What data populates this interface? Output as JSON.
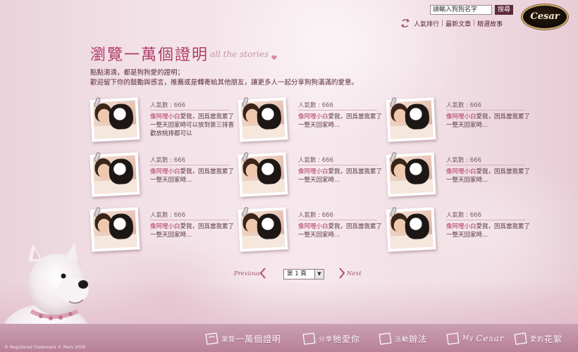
{
  "header": {
    "search_placeholder": "請輸入狗狗名字",
    "search_button": "搜尋",
    "links": [
      "人氣排行",
      "最新文章",
      "精選故事"
    ],
    "logo_text": "Cesar"
  },
  "title": {
    "main": "瀏覽一萬個證明",
    "sub": "all the stories"
  },
  "intro": {
    "line1": "點點滴滴，都是狗狗愛的證明；",
    "line2": "歡迎留下你的鼓勵與感言，推薦或是轉寄給其他朋友，讓更多人一起分享狗狗滿滿的愛意。"
  },
  "stories": [
    {
      "popularity": "人氣數 : 666",
      "highlight": "像阿哩小白",
      "text": "愛我，因爲當我累了一整天回家時可以放到第三排喜歡放桃排都可以"
    },
    {
      "popularity": "人氣數 : 666",
      "highlight": "像阿哩小白",
      "text": "愛我，因爲當我累了一整天回家時..."
    },
    {
      "popularity": "人氣數 : 666",
      "highlight": "像阿哩小白",
      "text": "愛我，因爲當我累了一整天回家時..."
    },
    {
      "popularity": "人氣數 : 666",
      "highlight": "像阿哩小白",
      "text": "愛我，因爲當我累了一整天回家時..."
    },
    {
      "popularity": "人氣數 : 666",
      "highlight": "像阿哩小白",
      "text": "愛我，因爲當我累了一整天回家時..."
    },
    {
      "popularity": "人氣數 : 666",
      "highlight": "像阿哩小白",
      "text": "愛我，因爲當我累了一整天回家時..."
    },
    {
      "popularity": "人氣數 : 666",
      "highlight": "像阿哩小白",
      "text": "愛我，因爲當我累了一整天回家時..."
    },
    {
      "popularity": "人氣數 : 666",
      "highlight": "像阿哩小白",
      "text": "愛我，因爲當我累了一整天回家時..."
    },
    {
      "popularity": "人氣數 : 666",
      "highlight": "像阿哩小白",
      "text": "愛我，因爲當我累了一整天回家時..."
    }
  ],
  "pagination": {
    "previous": "Previous",
    "next": "Next",
    "current_page": "第 1 頁"
  },
  "nav": {
    "item1": "瀏覽一萬個證明",
    "item2": "分享牠愛你",
    "item3": "活動辦法",
    "item4_prefix": "My",
    "item4": "Cesar",
    "item5": "愛的花絮"
  },
  "footer": {
    "copyright": "® Registered Trademark © Mars 2009"
  },
  "colors": {
    "accent": "#b03b68",
    "nav_bar": "#c096a8",
    "search_button": "#5d2a3d"
  }
}
